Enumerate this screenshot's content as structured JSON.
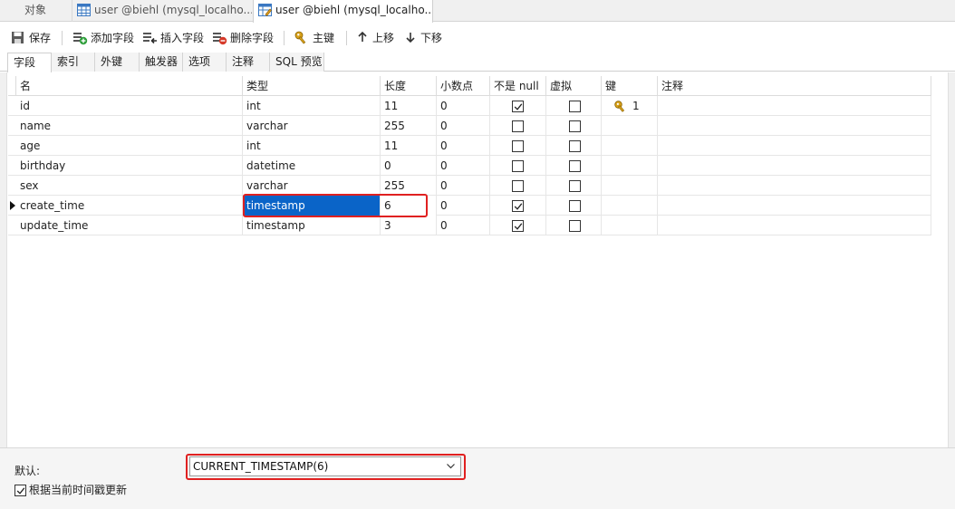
{
  "doc_tabs": [
    {
      "label": "对象"
    },
    {
      "label": "user @biehl (mysql_localho..."
    },
    {
      "label": "user @biehl (mysql_localho..."
    }
  ],
  "toolbar": {
    "save": "保存",
    "add_field": "添加字段",
    "insert_field": "插入字段",
    "delete_field": "删除字段",
    "primary_key": "主键",
    "move_up": "上移",
    "move_down": "下移"
  },
  "sub_tabs": [
    "字段",
    "索引",
    "外键",
    "触发器",
    "选项",
    "注释",
    "SQL 预览"
  ],
  "columns": {
    "name": "名",
    "type": "类型",
    "length": "长度",
    "decimals": "小数点",
    "not_null": "不是 null",
    "virtual": "虚拟",
    "key": "键",
    "comment": "注释"
  },
  "rows": [
    {
      "name": "id",
      "type": "int",
      "length": "11",
      "decimals": "0",
      "not_null": true,
      "virtual": false,
      "key": "1"
    },
    {
      "name": "name",
      "type": "varchar",
      "length": "255",
      "decimals": "0",
      "not_null": false,
      "virtual": false,
      "key": ""
    },
    {
      "name": "age",
      "type": "int",
      "length": "11",
      "decimals": "0",
      "not_null": false,
      "virtual": false,
      "key": ""
    },
    {
      "name": "birthday",
      "type": "datetime",
      "length": "0",
      "decimals": "0",
      "not_null": false,
      "virtual": false,
      "key": ""
    },
    {
      "name": "sex",
      "type": "varchar",
      "length": "255",
      "decimals": "0",
      "not_null": false,
      "virtual": false,
      "key": ""
    },
    {
      "name": "create_time",
      "type": "timestamp",
      "length": "6",
      "decimals": "0",
      "not_null": true,
      "virtual": false,
      "key": ""
    },
    {
      "name": "update_time",
      "type": "timestamp",
      "length": "3",
      "decimals": "0",
      "not_null": true,
      "virtual": false,
      "key": ""
    }
  ],
  "selected_row": 5,
  "bottom": {
    "default_label": "默认:",
    "default_value": "CURRENT_TIMESTAMP(6)",
    "on_update_label": "根据当前时间戳更新",
    "on_update_checked": true
  },
  "colors": {
    "selection": "#0a64c8",
    "highlight_box": "#e02020",
    "key_icon": "#d9a21b"
  },
  "icons": {
    "save": "floppy-disk-icon",
    "add_field": "add-field-icon",
    "insert_field": "insert-field-icon",
    "delete_field": "delete-field-icon",
    "primary_key": "key-icon",
    "move_up": "arrow-up-icon",
    "move_down": "arrow-down-icon"
  }
}
